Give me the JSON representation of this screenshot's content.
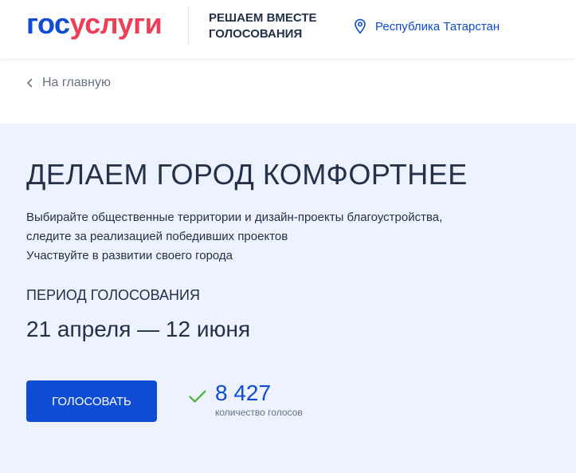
{
  "header": {
    "logo_part1": "гос",
    "logo_part2": "услуги",
    "project_title": "Решаем вместе голосования",
    "region_icon": "location-pin-icon",
    "region": "Республика Татарстан"
  },
  "breadcrumb": {
    "icon": "chevron-left-icon",
    "label": "На главную"
  },
  "hero": {
    "title": "Делаем город комфортнее",
    "description": [
      "Выбирайте общественные территории и дизайн-проекты благоустройства,",
      "следите за реализацией победивших проектов",
      "Участвуйте в развитии своего города"
    ],
    "period_label": "Период голосования",
    "period_value": "21 апреля — 12 июня",
    "vote_button": "Голосовать",
    "votes_icon": "check-icon",
    "votes_count": "8 427",
    "votes_caption": "количество голосов"
  },
  "colors": {
    "brand_blue": "#0d4cd3",
    "brand_red": "#ee3f58",
    "text_dark": "#233149",
    "text_muted": "#66727f",
    "hero_background": "#edf2fe",
    "success_green": "#5ab34a"
  }
}
